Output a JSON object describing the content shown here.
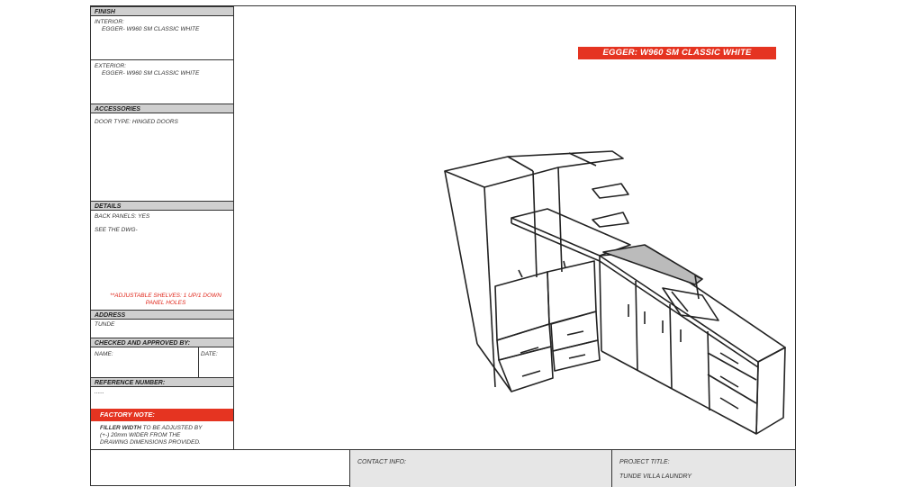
{
  "finish": {
    "header": "FINISH",
    "interior_label": "INTERIOR:",
    "interior_value": "EGGER- W960 SM CLASSIC WHITE",
    "exterior_label": "EXTERIOR:",
    "exterior_value": "EGGER- W960 SM CLASSIC WHITE"
  },
  "accessories": {
    "header": "ACCESSORIES",
    "door_type": "DOOR TYPE:  HINGED DOORS"
  },
  "details": {
    "header": "DETAILS",
    "back_panels": "BACK PANELS:  YES",
    "see_dwg": "SEE THE DWG-",
    "note_line1": "**ADJUSTABLE SHELVES: 1 UP/1 DOWN",
    "note_line2": "PANEL HOLES"
  },
  "address": {
    "header": "ADDRESS",
    "value": "TUNDE"
  },
  "checked": {
    "header": "CHECKED AND APPROVED BY:",
    "name_label": "NAME:",
    "date_label": "DATE:"
  },
  "reference": {
    "header": "REFERENCE NUMBER:",
    "value": "......"
  },
  "factory_note": {
    "header": "FACTORY NOTE:",
    "bold": "FILLER WIDTH",
    "line1_rest": " TO BE ADJUSTED BY",
    "line2": "(+-) 20mm WIDER FROM THE",
    "line3": "DRAWING DIMENSIONS PROVIDED."
  },
  "footer": {
    "contact_label": "CONTACT INFO:",
    "project_label": "PROJECT TITLE:",
    "project_value": "TUNDE VILLA    LAUNDRY"
  },
  "material_badge": "EGGER: W960 SM CLASSIC WHITE",
  "colors": {
    "accent": "#e53421",
    "header_bg": "#cfcfcf",
    "footer_bg": "#e6e6e6"
  }
}
